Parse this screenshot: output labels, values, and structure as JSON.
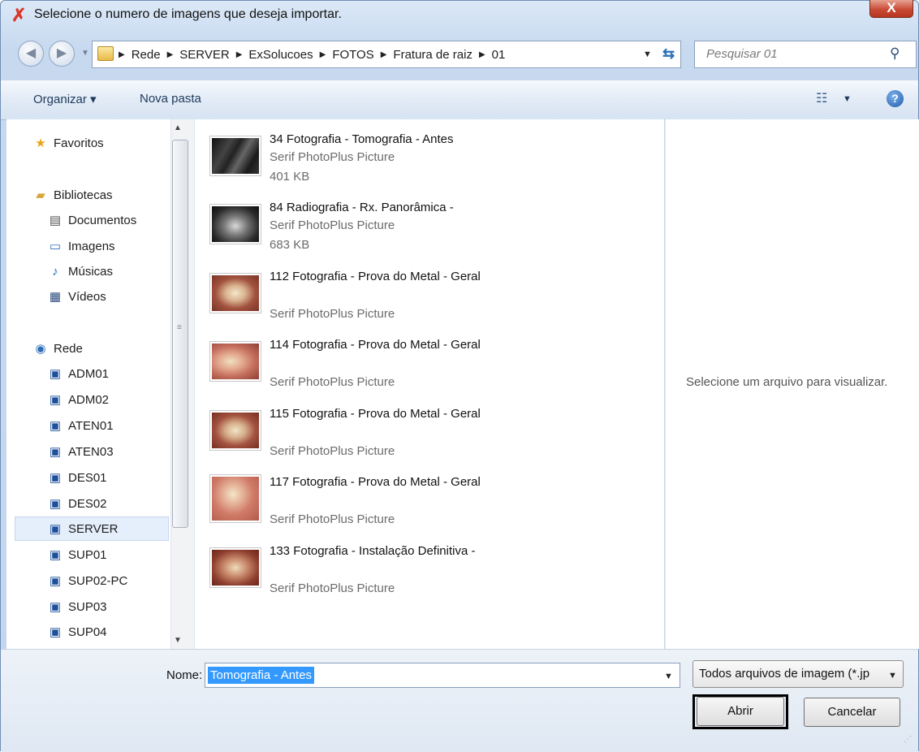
{
  "window": {
    "title": "Selecione o numero de imagens que deseja importar.",
    "close_label": "X"
  },
  "address": {
    "crumbs": [
      "Rede",
      "SERVER",
      "ExSolucoes",
      "FOTOS",
      "Fratura de raiz",
      "01"
    ]
  },
  "search": {
    "placeholder": "Pesquisar 01"
  },
  "toolbar": {
    "organize_label": "Organizar ▾",
    "new_folder_label": "Nova pasta"
  },
  "sidebar": {
    "favorites": "Favoritos",
    "libraries": "Bibliotecas",
    "library_items": [
      "Documentos",
      "Imagens",
      "Músicas",
      "Vídeos"
    ],
    "network": "Rede",
    "network_items": [
      "ADM01",
      "ADM02",
      "ATEN01",
      "ATEN03",
      "DES01",
      "DES02",
      "SERVER",
      "SUP01",
      "SUP02-PC",
      "SUP03",
      "SUP04"
    ],
    "selected": "SERVER"
  },
  "files": [
    {
      "name": "34 Fotografia - Tomografia - Antes",
      "type": "Serif PhotoPlus Picture",
      "size": "401 KB"
    },
    {
      "name": "84 Radiografia - Rx. Panorâmica -",
      "type": "Serif PhotoPlus Picture",
      "size": "683 KB"
    },
    {
      "name": "112 Fotografia - Prova do Metal - Geral",
      "type": "Serif PhotoPlus Picture",
      "size": ""
    },
    {
      "name": "114 Fotografia - Prova do Metal - Geral",
      "type": "Serif PhotoPlus Picture",
      "size": ""
    },
    {
      "name": "115 Fotografia - Prova do Metal - Geral",
      "type": "Serif PhotoPlus Picture",
      "size": ""
    },
    {
      "name": "117 Fotografia - Prova do Metal - Geral",
      "type": "Serif PhotoPlus Picture",
      "size": ""
    },
    {
      "name": "133 Fotografia - Instalação Definitiva -",
      "type": "Serif PhotoPlus Picture",
      "size": ""
    }
  ],
  "preview": {
    "message": "Selecione um arquivo para visualizar."
  },
  "footer": {
    "name_label": "Nome:",
    "name_value": "Tomografia - Antes",
    "file_type": "Todos arquivos de imagem (*.jp",
    "open_label": "Abrir",
    "cancel_label": "Cancelar"
  }
}
